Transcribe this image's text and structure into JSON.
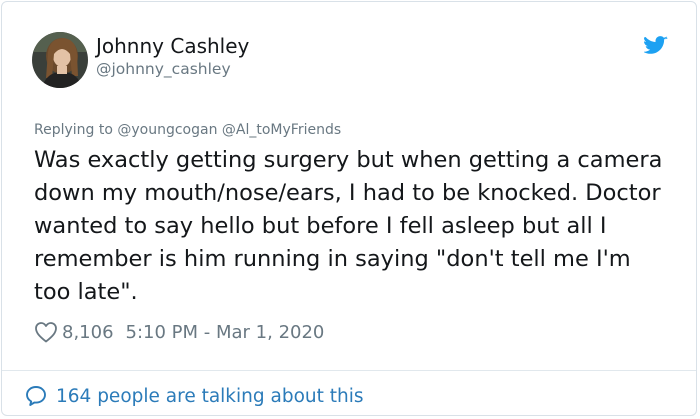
{
  "tweet": {
    "author": {
      "display_name": "Johnny Cashley",
      "handle": "@johnny_cashley"
    },
    "replying_to": "Replying to @youngcogan @Al_toMyFriends",
    "text": "Was exactly getting surgery but when getting a camera down my mouth/nose/ears, I had to be knocked. Doctor wanted to say hello but before I fell asleep but all I remember is him running in saying \"don't tell me I'm too late\".",
    "likes": "8,106",
    "timestamp": "5:10 PM - Mar 1, 2020",
    "conversation": "164 people are talking about this"
  },
  "icons": {
    "brand": "twitter-bird-icon",
    "like": "heart-icon",
    "reply": "speech-bubble-icon"
  },
  "colors": {
    "brand_blue": "#1da1f2",
    "link_blue": "#2b7bb9",
    "text_primary": "#14171a",
    "text_secondary": "#697882",
    "border": "#d9e1e8"
  }
}
